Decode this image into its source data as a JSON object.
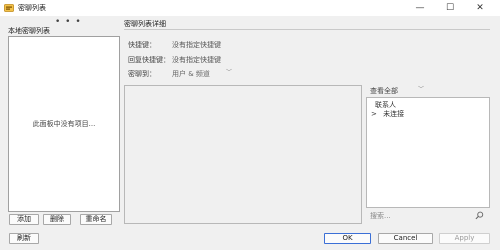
{
  "window": {
    "title": "密聊列表",
    "minimize_glyph": "—",
    "maximize_glyph": "☐",
    "close_glyph": "✕"
  },
  "left_panel": {
    "title": "本地密聊列表",
    "dots": "• • •",
    "empty_text": "此面板中没有项目...",
    "buttons": {
      "add": "添加",
      "delete": "删除",
      "rename": "重命名"
    }
  },
  "details": {
    "title": "密聊列表详细",
    "shortcut_label": "快捷键：",
    "shortcut_value": "没有指定快捷键",
    "reply_shortcut_label": "回复快捷键：",
    "reply_shortcut_value": "没有指定快捷键",
    "send_to_label": "密聊到：",
    "send_to_value": "用户 & 频道"
  },
  "contacts": {
    "filter_value": "查看全部",
    "items": [
      {
        "label": "联系人",
        "expander": ""
      },
      {
        "label": "未连接",
        "expander": ">"
      }
    ],
    "search_placeholder": "搜索..."
  },
  "footer": {
    "refresh": "刷新",
    "ok": "OK",
    "cancel": "Cancel",
    "apply": "Apply"
  }
}
